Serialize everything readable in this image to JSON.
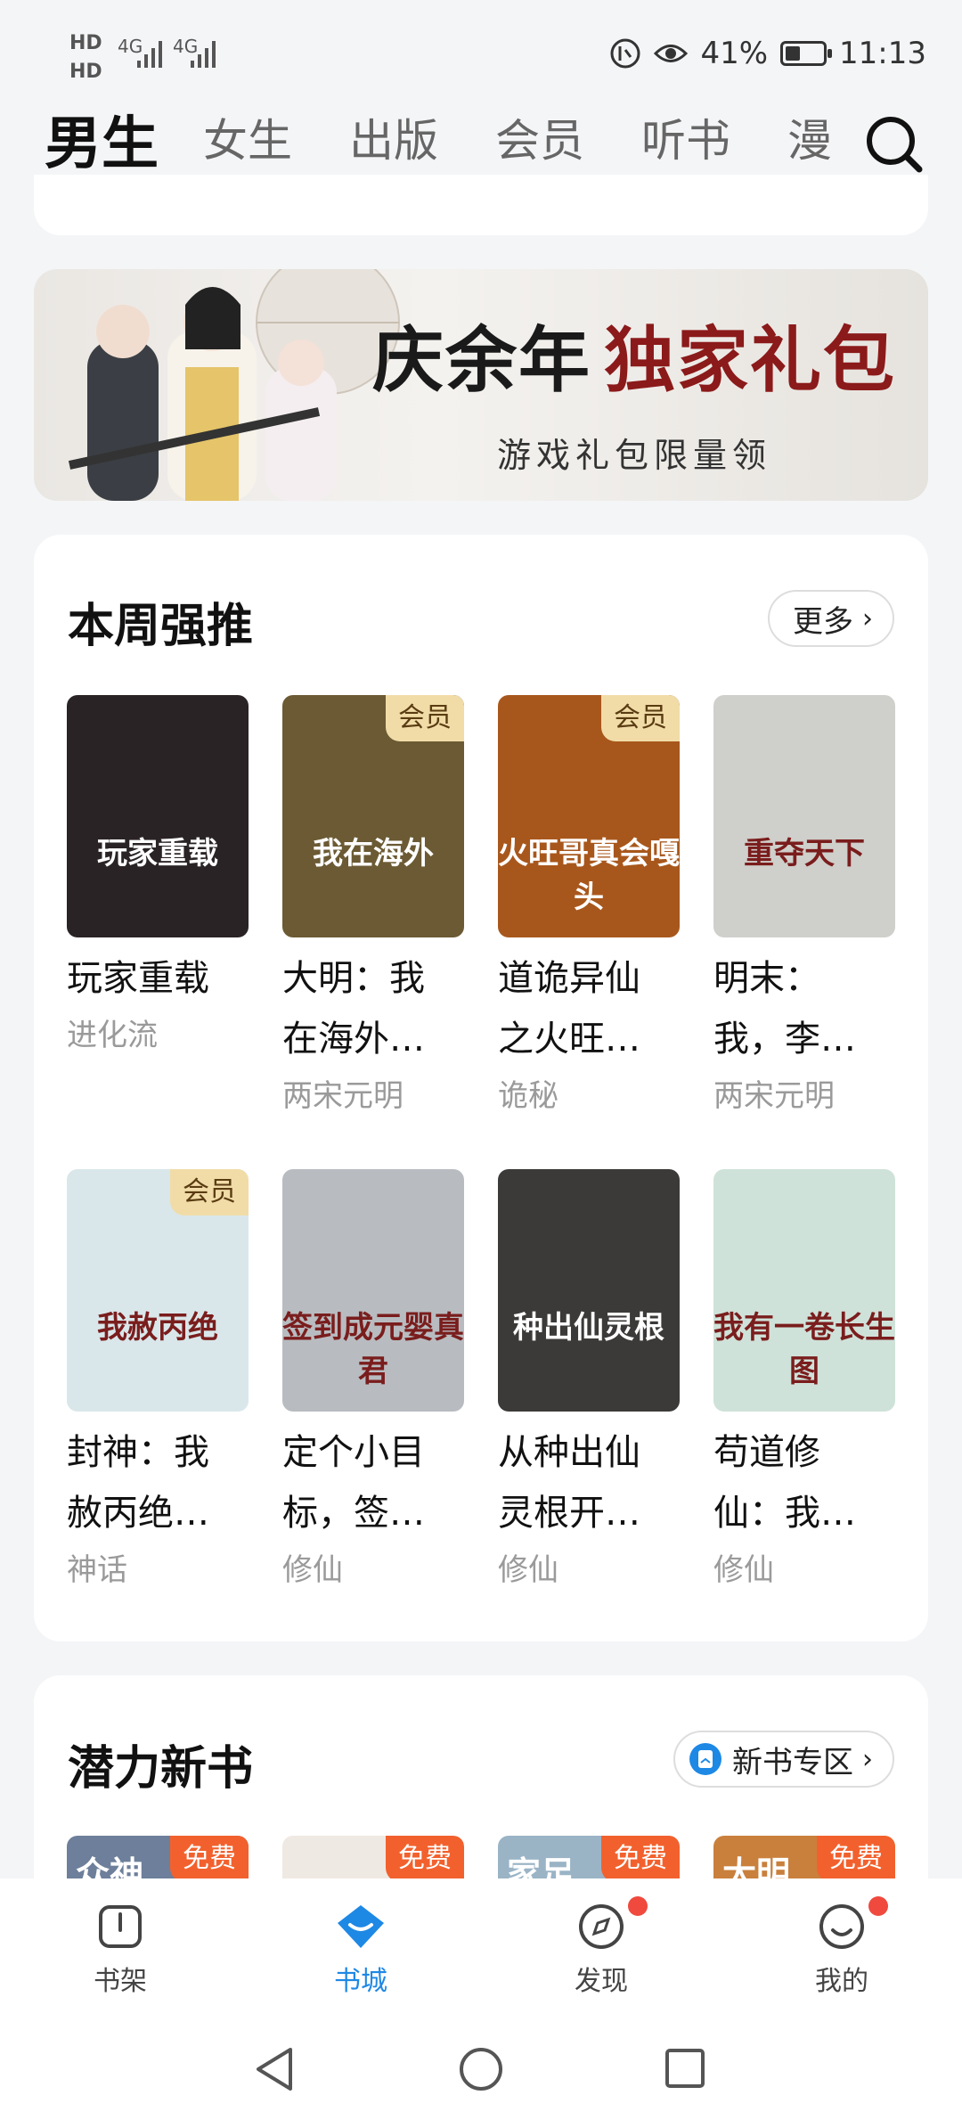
{
  "status_bar": {
    "sim1": "HD",
    "sim2": "HD",
    "net1": "4G",
    "net2": "4G",
    "battery_percent_text": "41%",
    "battery_level": 0.41,
    "time": "11:13"
  },
  "tabs": [
    {
      "label": "男生",
      "active": true
    },
    {
      "label": "女生"
    },
    {
      "label": "出版"
    },
    {
      "label": "会员"
    },
    {
      "label": "听书"
    },
    {
      "label": "漫"
    }
  ],
  "banner": {
    "title_black": "庆余年",
    "title_red": "独家礼包",
    "subtitle": "游戏礼包限量领"
  },
  "weekly": {
    "title": "本周强推",
    "more_label": "更多",
    "books": [
      {
        "title_line1": "玩家重载",
        "title_line2": "",
        "genre": "进化流",
        "badge": "",
        "cover_text": "玩家重载",
        "cover_bg": "#2a2325"
      },
      {
        "title_line1": "大明：我",
        "title_line2": "在海外…",
        "genre": "两宋元明",
        "badge": "会员",
        "cover_text": "我在海外",
        "cover_bg": "#6b5a33"
      },
      {
        "title_line1": "道诡异仙",
        "title_line2": "之火旺…",
        "genre": "诡秘",
        "badge": "会员",
        "cover_text": "火旺哥真会嘎头",
        "cover_bg": "#a8571c"
      },
      {
        "title_line1": "明末：",
        "title_line2": "我，李…",
        "genre": "两宋元明",
        "badge": "",
        "cover_text": "重夺天下",
        "cover_bg": "#cfcfcb"
      },
      {
        "title_line1": "封神：我",
        "title_line2": "赦丙绝…",
        "genre": "神话",
        "badge": "会员",
        "cover_text": "我赦丙绝",
        "cover_bg": "#d9e7ea"
      },
      {
        "title_line1": "定个小目",
        "title_line2": "标，签…",
        "genre": "修仙",
        "badge": "",
        "cover_text": "签到成元婴真君",
        "cover_bg": "#b8bcc0"
      },
      {
        "title_line1": "从种出仙",
        "title_line2": "灵根开…",
        "genre": "修仙",
        "badge": "",
        "cover_text": "种出仙灵根",
        "cover_bg": "#3c3a38"
      },
      {
        "title_line1": "苟道修",
        "title_line2": "仙：我…",
        "genre": "修仙",
        "badge": "",
        "cover_text": "我有一卷长生图",
        "cover_bg": "#cfe2d9"
      }
    ]
  },
  "new_books": {
    "title": "潜力新书",
    "zone_label": "新书专区",
    "previews": [
      {
        "badge": "免费",
        "cover_text": "众神",
        "cover_bg": "#6d7f9a"
      },
      {
        "badge": "免费",
        "cover_text": "",
        "cover_bg": "#efe9e3"
      },
      {
        "badge": "免费",
        "cover_text": "家足",
        "cover_bg": "#9ab4c6"
      },
      {
        "badge": "免费",
        "cover_text": "大明",
        "cover_bg": "#c9803c"
      }
    ]
  },
  "bottom_nav": [
    {
      "label": "书架"
    },
    {
      "label": "书城",
      "active": true
    },
    {
      "label": "发现"
    },
    {
      "label": "我的"
    }
  ],
  "colors": {
    "accent": "#1e88e5",
    "vip_badge": "#f1dca8",
    "free_badge": "#f2612d",
    "notify_dot": "#f0493e"
  }
}
